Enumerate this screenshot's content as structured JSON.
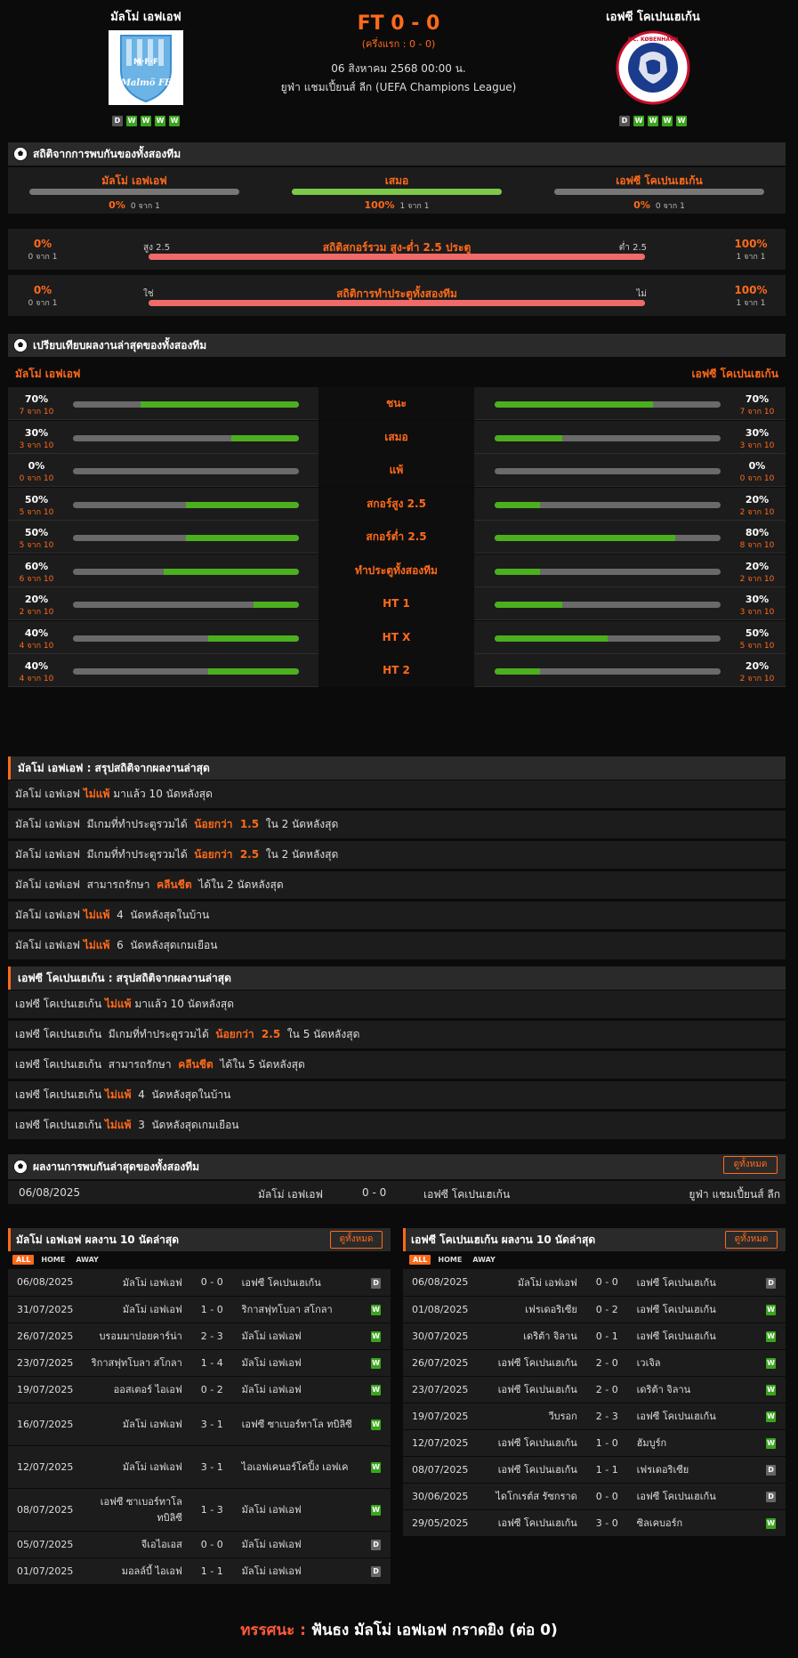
{
  "header": {
    "home": {
      "name": "มัลโม่ เอฟเอฟ",
      "form": [
        "D",
        "W",
        "W",
        "W",
        "W"
      ],
      "logo_text": "Malmö FF",
      "logo_mark": "M·F·F"
    },
    "away": {
      "name": "เอฟซี โคเปนเฮเก้น",
      "form": [
        "D",
        "W",
        "W",
        "W",
        "W"
      ],
      "logo_text": "F.C. KØBENHAVN"
    },
    "score": "FT 0 - 0",
    "half": "(ครึ่งแรก : 0 - 0)",
    "date": "06 สิงหาคม 2568 00:00 น.",
    "league": "ยูฟ่า แชมเปี้ยนส์ ลีก (UEFA Champions League)"
  },
  "h2h_stats": {
    "title": "สถิติจากการพบกันของทั้งสองทีม",
    "cols": [
      {
        "label": "มัลโม่ เอฟเอฟ",
        "pct": "0%",
        "sub": "0 จาก 1",
        "fill": 0,
        "color": "#777777"
      },
      {
        "label": "เสมอ",
        "pct": "100%",
        "sub": "1 จาก 1",
        "fill": 100,
        "color": "#7ec84a"
      },
      {
        "label": "เอฟซี โคเปนเฮเก้น",
        "pct": "0%",
        "sub": "0 จาก 1",
        "fill": 0,
        "color": "#777777"
      }
    ],
    "ou": {
      "title": "สถิติสกอร์รวม สูง-ต่ำ 2.5 ประตู",
      "left_label": "สูง 2.5",
      "right_label": "ต่ำ 2.5",
      "left_pct": "0%",
      "left_sub": "0 จาก 1",
      "right_pct": "100%",
      "right_sub": "1 จาก 1",
      "fill": 100
    },
    "btts": {
      "title": "สถิติการทำประตูทั้งสองทีม",
      "left_label": "ใช่",
      "right_label": "ไม่",
      "left_pct": "0%",
      "left_sub": "0 จาก 1",
      "right_pct": "100%",
      "right_sub": "1 จาก 1",
      "fill": 100
    }
  },
  "compare": {
    "title": "เปรียบเทียบผลงานล่าสุดของทั้งสองทีม",
    "home": "มัลโม่ เอฟเอฟ",
    "away": "เอฟซี โคเปนเฮเก้น",
    "rows": [
      {
        "label": "ชนะ",
        "lp": "70%",
        "ls": "7 จาก 10",
        "lf": 70,
        "rp": "70%",
        "rs": "7 จาก 10",
        "rf": 70
      },
      {
        "label": "เสมอ",
        "lp": "30%",
        "ls": "3 จาก 10",
        "lf": 30,
        "rp": "30%",
        "rs": "3 จาก 10",
        "rf": 30
      },
      {
        "label": "แพ้",
        "lp": "0%",
        "ls": "0 จาก 10",
        "lf": 0,
        "rp": "0%",
        "rs": "0 จาก 10",
        "rf": 0
      },
      {
        "label": "สกอร์สูง 2.5",
        "lp": "50%",
        "ls": "5 จาก 10",
        "lf": 50,
        "rp": "20%",
        "rs": "2 จาก 10",
        "rf": 20
      },
      {
        "label": "สกอร์ต่ำ 2.5",
        "lp": "50%",
        "ls": "5 จาก 10",
        "lf": 50,
        "rp": "80%",
        "rs": "8 จาก 10",
        "rf": 80
      },
      {
        "label": "ทำประตูทั้งสองทีม",
        "lp": "60%",
        "ls": "6 จาก 10",
        "lf": 60,
        "rp": "20%",
        "rs": "2 จาก 10",
        "rf": 20
      },
      {
        "label": "HT 1",
        "lp": "20%",
        "ls": "2 จาก 10",
        "lf": 20,
        "rp": "30%",
        "rs": "3 จาก 10",
        "rf": 30
      },
      {
        "label": "HT X",
        "lp": "40%",
        "ls": "4 จาก 10",
        "lf": 40,
        "rp": "50%",
        "rs": "5 จาก 10",
        "rf": 50
      },
      {
        "label": "HT 2",
        "lp": "40%",
        "ls": "4 จาก 10",
        "lf": 40,
        "rp": "20%",
        "rs": "2 จาก 10",
        "rf": 20
      }
    ]
  },
  "summary_home": {
    "title": "มัลโม่ เอฟเอฟ : สรุปสถิติจากผลงานล่าสุด",
    "rows": [
      {
        "a": "มัลโม่ เอฟเอฟ ",
        "h": "ไม่แพ้",
        "b": " มาแล้ว 10 นัดหลังสุด"
      },
      {
        "a": "มัลโม่ เอฟเอฟ  มีเกมที่ทำประตูรวมได้  ",
        "h": "น้อยกว่า  1.5",
        "b": "  ใน 2 นัดหลังสุด"
      },
      {
        "a": "มัลโม่ เอฟเอฟ  มีเกมที่ทำประตูรวมได้  ",
        "h": "น้อยกว่า  2.5",
        "b": "  ใน 2 นัดหลังสุด"
      },
      {
        "a": "มัลโม่ เอฟเอฟ  สามารถรักษา  ",
        "h": "คลีนชีต",
        "b": "  ได้ใน 2 นัดหลังสุด"
      },
      {
        "a": "มัลโม่ เอฟเอฟ ",
        "h": "ไม่แพ้",
        "b": "  4  นัดหลังสุดในบ้าน"
      },
      {
        "a": "มัลโม่ เอฟเอฟ ",
        "h": "ไม่แพ้",
        "b": "  6  นัดหลังสุดเกมเยือน"
      }
    ]
  },
  "summary_away": {
    "title": "เอฟซี โคเปนเฮเก้น : สรุปสถิติจากผลงานล่าสุด",
    "rows": [
      {
        "a": "เอฟซี โคเปนเฮเก้น ",
        "h": "ไม่แพ้",
        "b": " มาแล้ว 10 นัดหลังสุด"
      },
      {
        "a": "เอฟซี โคเปนเฮเก้น  มีเกมที่ทำประตูรวมได้  ",
        "h": "น้อยกว่า  2.5",
        "b": "  ใน 5 นัดหลังสุด"
      },
      {
        "a": "เอฟซี โคเปนเฮเก้น  สามารถรักษา  ",
        "h": "คลีนชีต",
        "b": "  ได้ใน 5 นัดหลังสุด"
      },
      {
        "a": "เอฟซี โคเปนเฮเก้น ",
        "h": "ไม่แพ้",
        "b": "  4  นัดหลังสุดในบ้าน"
      },
      {
        "a": "เอฟซี โคเปนเฮเก้น ",
        "h": "ไม่แพ้",
        "b": "  3  นัดหลังสุดเกมเยือน"
      }
    ]
  },
  "h2h_results": {
    "title": "ผลงานการพบกันล่าสุดของทั้งสองทีม",
    "btn": "ดูทั้งหมด",
    "row": {
      "date": "06/08/2025",
      "home": "มัลโม่ เอฟเอฟ",
      "score": "0 - 0",
      "away": "เอฟซี โคเปนเฮเก้น",
      "league": "ยูฟ่า แชมเปี้ยนส์ ลีก"
    }
  },
  "last10_home": {
    "title": "มัลโม่ เอฟเอฟ ผลงาน 10 นัดล่าสุด",
    "btn": "ดูทั้งหมด",
    "tabs": [
      "ALL",
      "HOME",
      "AWAY"
    ],
    "rows": [
      {
        "date": "06/08/2025",
        "home": "มัลโม่ เอฟเอฟ",
        "score": "0 - 0",
        "away": "เอฟซี โคเปนเฮเก้น",
        "res": "D"
      },
      {
        "date": "31/07/2025",
        "home": "มัลโม่ เอฟเอฟ",
        "score": "1 - 0",
        "away": "ริกาสฟุทโบลา สโกลา",
        "res": "W"
      },
      {
        "date": "26/07/2025",
        "home": "บรอมมาปอยคาร์น่า",
        "score": "2 - 3",
        "away": "มัลโม่ เอฟเอฟ",
        "res": "W"
      },
      {
        "date": "23/07/2025",
        "home": "ริกาสฟุทโบลา สโกลา",
        "score": "1 - 4",
        "away": "มัลโม่ เอฟเอฟ",
        "res": "W"
      },
      {
        "date": "19/07/2025",
        "home": "ออสเตอร์ ไอเอฟ",
        "score": "0 - 2",
        "away": "มัลโม่ เอฟเอฟ",
        "res": "W"
      },
      {
        "date": "16/07/2025",
        "home": "มัลโม่ เอฟเอฟ",
        "score": "3 - 1",
        "away": "เอฟซี ซาเบอร์ทาโล ทบิลิซี",
        "res": "W"
      },
      {
        "date": "12/07/2025",
        "home": "มัลโม่ เอฟเอฟ",
        "score": "3 - 1",
        "away": "ไอเอฟเคนอร์โคปิ้ง เอฟเค",
        "res": "W"
      },
      {
        "date": "08/07/2025",
        "home": "เอฟซี ซาเบอร์ทาโล ทบิลิซี",
        "score": "1 - 3",
        "away": "มัลโม่ เอฟเอฟ",
        "res": "W"
      },
      {
        "date": "05/07/2025",
        "home": "จีเอไอเอส",
        "score": "0 - 0",
        "away": "มัลโม่ เอฟเอฟ",
        "res": "D"
      },
      {
        "date": "01/07/2025",
        "home": "มอลล์บี้ ไอเอฟ",
        "score": "1 - 1",
        "away": "มัลโม่ เอฟเอฟ",
        "res": "D"
      }
    ]
  },
  "last10_away": {
    "title": "เอฟซี โคเปนเฮเก้น ผลงาน 10 นัดล่าสุด",
    "btn": "ดูทั้งหมด",
    "tabs": [
      "ALL",
      "HOME",
      "AWAY"
    ],
    "rows": [
      {
        "date": "06/08/2025",
        "home": "มัลโม่ เอฟเอฟ",
        "score": "0 - 0",
        "away": "เอฟซี โคเปนเฮเก้น",
        "res": "D"
      },
      {
        "date": "01/08/2025",
        "home": "เฟรเดอริเซีย",
        "score": "0 - 2",
        "away": "เอฟซี โคเปนเฮเก้น",
        "res": "W"
      },
      {
        "date": "30/07/2025",
        "home": "เดริต้า จิลาน",
        "score": "0 - 1",
        "away": "เอฟซี โคเปนเฮเก้น",
        "res": "W"
      },
      {
        "date": "26/07/2025",
        "home": "เอฟซี โคเปนเฮเก้น",
        "score": "2 - 0",
        "away": "เวเจิล",
        "res": "W"
      },
      {
        "date": "23/07/2025",
        "home": "เอฟซี โคเปนเฮเก้น",
        "score": "2 - 0",
        "away": "เดริต้า จิลาน",
        "res": "W"
      },
      {
        "date": "19/07/2025",
        "home": "วีบรอก",
        "score": "2 - 3",
        "away": "เอฟซี โคเปนเฮเก้น",
        "res": "W"
      },
      {
        "date": "12/07/2025",
        "home": "เอฟซี โคเปนเฮเก้น",
        "score": "1 - 0",
        "away": "ฮัมบูร์ก",
        "res": "W"
      },
      {
        "date": "08/07/2025",
        "home": "เอฟซี โคเปนเฮเก้น",
        "score": "1 - 1",
        "away": "เฟรเดอริเซีย",
        "res": "D"
      },
      {
        "date": "30/06/2025",
        "home": "ไดโกเรต์ส รัซกราด",
        "score": "0 - 0",
        "away": "เอฟซี โคเปนเฮเก้น",
        "res": "D"
      },
      {
        "date": "29/05/2025",
        "home": "เอฟซี โคเปนเฮเก้น",
        "score": "3 - 0",
        "away": "ซิลเคบอร์ก",
        "res": "W"
      }
    ]
  },
  "verdict": {
    "label": "ทรรศนะ :",
    "text": "ฟันธง มัลโม่ เอฟเอฟ กราดยิง (ต่อ 0)"
  },
  "colors": {
    "accent": "#ff6a1a",
    "green": "#4caf1e",
    "red_bar": "#f06a6a"
  }
}
